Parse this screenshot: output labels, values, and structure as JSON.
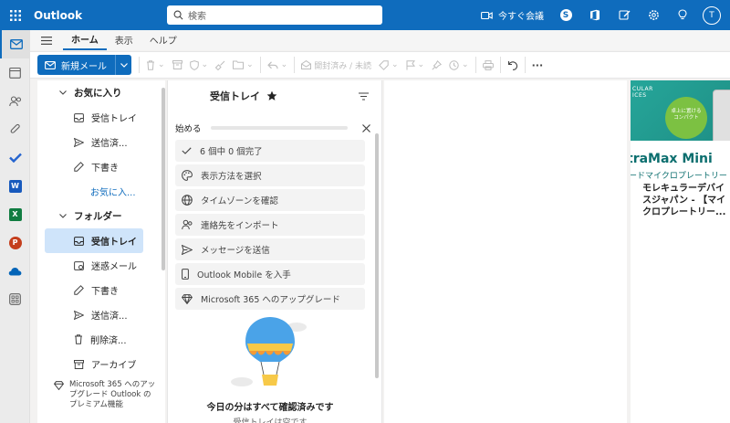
{
  "topbar": {
    "app_name": "Outlook",
    "search_placeholder": "検索",
    "meet_now": "今すぐ会議",
    "avatar_initial": "T"
  },
  "ribbon": {
    "tabs": [
      "ホーム",
      "表示",
      "ヘルプ"
    ],
    "active_tab": "ホーム",
    "new_mail": "新規メール",
    "mark_read": "開封済み / 未読",
    "more": "···"
  },
  "folders": {
    "favorites_header": "お気に入り",
    "favorites": [
      "受信トレイ",
      "送信済...",
      "下書き"
    ],
    "add_favorite": "お気に入...",
    "folders_header": "フォルダー",
    "items": [
      "受信トレイ",
      "迷惑メール",
      "下書き",
      "送信済...",
      "削除済...",
      "アーカイブ"
    ],
    "promo": "Microsoft 365 へのアップグレード Outlook のプレミアム機能"
  },
  "message_list": {
    "title": "受信トレイ",
    "getting_started": "始める",
    "tasks": [
      "6 個中 0 個完了",
      "表示方法を選択",
      "タイムゾーンを確認",
      "連絡先をインポート",
      "メッセージを送信",
      "Outlook Mobile を入手",
      "Microsoft 365 へのアップグレード"
    ],
    "empty_title": "今日の分はすべて確認済みです",
    "empty_sub": "受信トレイは空です"
  },
  "ad": {
    "brand": "CULAR\nICES",
    "badge": "卓上に置ける\nコンパクト",
    "headline": "traMax Mini",
    "sub": "ードマイクロプレートリー",
    "description": "モレキュラーデバイスジャパン - 【マイクロプレートリー..."
  },
  "colors": {
    "brand_blue": "#0f6cbd",
    "selected": "#cfe4fa",
    "ad_green": "#26a69a"
  }
}
